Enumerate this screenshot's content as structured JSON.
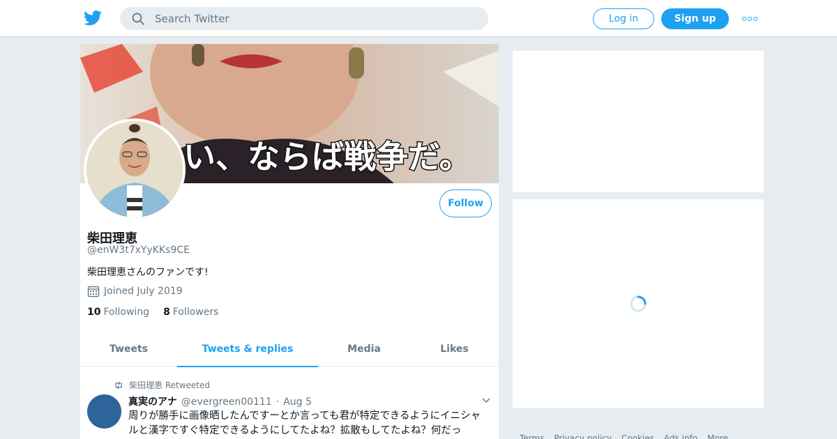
{
  "search": {
    "placeholder": "Search Twitter"
  },
  "header": {
    "login_label": "Log in",
    "signup_label": "Sign up"
  },
  "profile": {
    "banner_text": "い、ならば戦争だ。",
    "follow_label": "Follow",
    "name": "柴田理恵",
    "handle": "@enW3t7xYyKKs9CE",
    "bio": "柴田理恵さんのファンです!",
    "joined": "Joined July 2019",
    "following_count": "10",
    "following_label": "Following",
    "followers_count": "8",
    "followers_label": "Followers"
  },
  "tabs": [
    {
      "label": "Tweets"
    },
    {
      "label": "Tweets & replies"
    },
    {
      "label": "Media"
    },
    {
      "label": "Likes"
    }
  ],
  "tweet": {
    "retweeted_by": "柴田理恵",
    "retweeted_label": "Retweeted",
    "name": "真実のアナ",
    "handle": "@evergreen00111",
    "dot": "·",
    "date": "Aug 5",
    "text": "周りが勝手に画像晒したんですーとか言っても君が特定できるようにイニシャルと漢字ですぐ特定できるようにしてたよね？拡散もしてたよね？何だっ"
  },
  "footer": [
    "Terms",
    "Privacy policy",
    "Cookies",
    "Ads info",
    "More"
  ],
  "colors": {
    "accent": "#1da1f2",
    "background": "#e6ecf0",
    "muted": "#657786"
  },
  "icons": [
    "twitter-bird-icon",
    "search-icon",
    "more-dots-icon",
    "calendar-icon",
    "retweet-icon",
    "chevron-down-icon",
    "loading-spinner-icon"
  ]
}
